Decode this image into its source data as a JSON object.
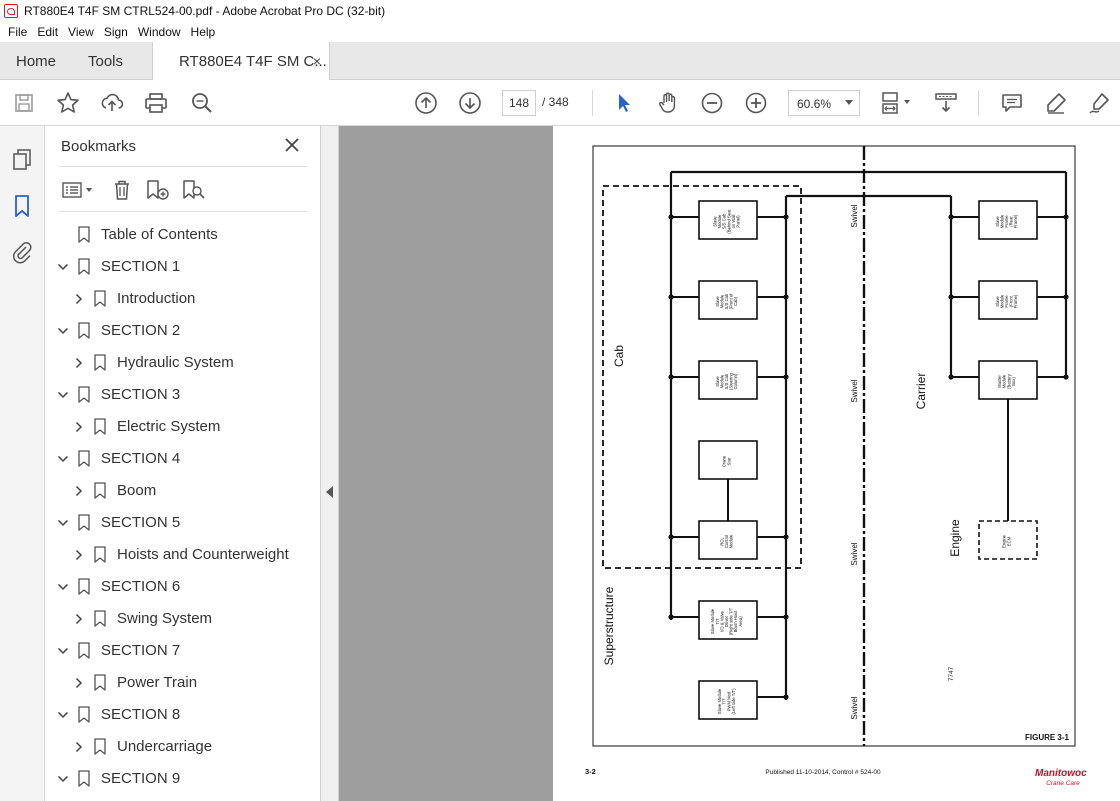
{
  "window": {
    "title": "RT880E4 T4F SM CTRL524-00.pdf - Adobe Acrobat Pro DC (32-bit)"
  },
  "menu": [
    "File",
    "Edit",
    "View",
    "Sign",
    "Window",
    "Help"
  ],
  "tabs": {
    "home": "Home",
    "tools": "Tools",
    "document": "RT880E4 T4F SM C...",
    "close": "×"
  },
  "toolbar": {
    "current_page": "148",
    "page_total": "/ 348",
    "zoom": "60.6%",
    "icons": [
      "save-icon",
      "star-icon",
      "upload-icon",
      "print-icon",
      "search-icon",
      "page-up-icon",
      "page-down-icon",
      "select-arrow-icon",
      "hand-icon",
      "zoom-out-icon",
      "zoom-in-icon",
      "fit-page-icon",
      "scroll-mode-icon",
      "comment-icon",
      "highlight-icon",
      "sign-icon"
    ]
  },
  "bookmarks": {
    "title": "Bookmarks",
    "items": [
      {
        "label": "Table of Contents",
        "level": 0,
        "expander": "none"
      },
      {
        "label": "SECTION 1",
        "level": 0,
        "expander": "expanded"
      },
      {
        "label": "Introduction",
        "level": 1,
        "expander": "collapsed"
      },
      {
        "label": "SECTION 2",
        "level": 0,
        "expander": "expanded"
      },
      {
        "label": "Hydraulic System",
        "level": 1,
        "expander": "collapsed"
      },
      {
        "label": "SECTION 3",
        "level": 0,
        "expander": "expanded"
      },
      {
        "label": "Electric System",
        "level": 1,
        "expander": "collapsed"
      },
      {
        "label": "SECTION 4",
        "level": 0,
        "expander": "expanded"
      },
      {
        "label": "Boom",
        "level": 1,
        "expander": "collapsed"
      },
      {
        "label": "SECTION 5",
        "level": 0,
        "expander": "expanded"
      },
      {
        "label": "Hoists and Counterweight",
        "level": 1,
        "expander": "collapsed"
      },
      {
        "label": "SECTION 6",
        "level": 0,
        "expander": "expanded"
      },
      {
        "label": "Swing System",
        "level": 1,
        "expander": "collapsed"
      },
      {
        "label": "SECTION 7",
        "level": 0,
        "expander": "expanded"
      },
      {
        "label": "Power Train",
        "level": 1,
        "expander": "collapsed"
      },
      {
        "label": "SECTION 8",
        "level": 0,
        "expander": "expanded"
      },
      {
        "label": "Undercarriage",
        "level": 1,
        "expander": "collapsed"
      },
      {
        "label": "SECTION 9",
        "level": 0,
        "expander": "expanded"
      }
    ]
  },
  "diagram": {
    "region_labels": {
      "cab": "Cab",
      "superstructure": "Superstructure",
      "carrier": "Carrier",
      "engine": "Engine"
    },
    "swivel_label": "Swivel",
    "modules": {
      "m1": [
        "Slave",
        "Module",
        "S/S Cab",
        "(Behind Seat",
        "on Wall",
        "Panel)"
      ],
      "m2": [
        "Slave",
        "Module",
        "S/S Cab",
        "(Front of",
        "Cab)"
      ],
      "m3": [
        "Slave",
        "Module",
        "S/S Cab",
        "(Steering",
        "Column)"
      ],
      "m4": [
        "Crane",
        "Star"
      ],
      "m5": [
        "RCL",
        "Control",
        "Module"
      ],
      "m6": [
        "Slave Module",
        "T/T",
        "I/O & Valve",
        "Driver",
        "(Right side T/T",
        "Boom Hoist",
        "Area)"
      ],
      "m7": [
        "Slave Module",
        "T/T",
        "PWM Mod",
        "(Left side T/T)"
      ],
      "r1": [
        "Slave",
        "Module",
        "Frame",
        "(Rear",
        "Frame)"
      ],
      "r2": [
        "Slave",
        "Module",
        "Frame",
        "(Front",
        "Frame)"
      ],
      "r3": [
        "Master",
        "Module",
        "(Battery",
        "Box)"
      ],
      "r4": [
        "Engine",
        "ECM"
      ]
    },
    "drawing_number": "7747",
    "figure_label": "FIGURE 3-1"
  },
  "footer": {
    "page_number": "3-2",
    "published": "Published 11-10-2014, Control # 524-00",
    "brand": "Manitowoc",
    "brand_sub": "Crane Care"
  }
}
